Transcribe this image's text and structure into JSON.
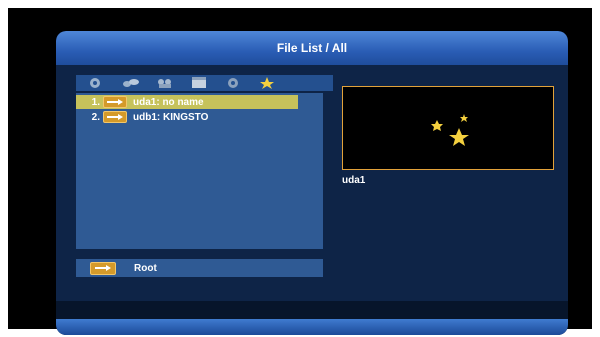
{
  "header": {
    "title": "File List / All"
  },
  "toolbar": {
    "icons": [
      "music-icon",
      "photo-icon",
      "video-icon",
      "movie-icon",
      "settings-icon",
      "star-icon"
    ]
  },
  "file_list": {
    "items": [
      {
        "number": "1.",
        "label": "uda1: no name",
        "icon": "usb-drive-icon",
        "selected": true
      },
      {
        "number": "2.",
        "label": "udb1: KINGSTO",
        "icon": "usb-drive-icon",
        "selected": false
      }
    ]
  },
  "root": {
    "label": "Root",
    "icon": "usb-drive-icon"
  },
  "preview": {
    "caption": "uda1",
    "image": "stars-icon"
  },
  "colors": {
    "header_blue": "#2a5db5",
    "panel_bg": "#0e2447",
    "list_bg": "#2f5a94",
    "selection": "#c6c25b",
    "preview_border": "#e2a23a",
    "usb_icon": "#d49a2a",
    "star": "#f4d03f"
  }
}
